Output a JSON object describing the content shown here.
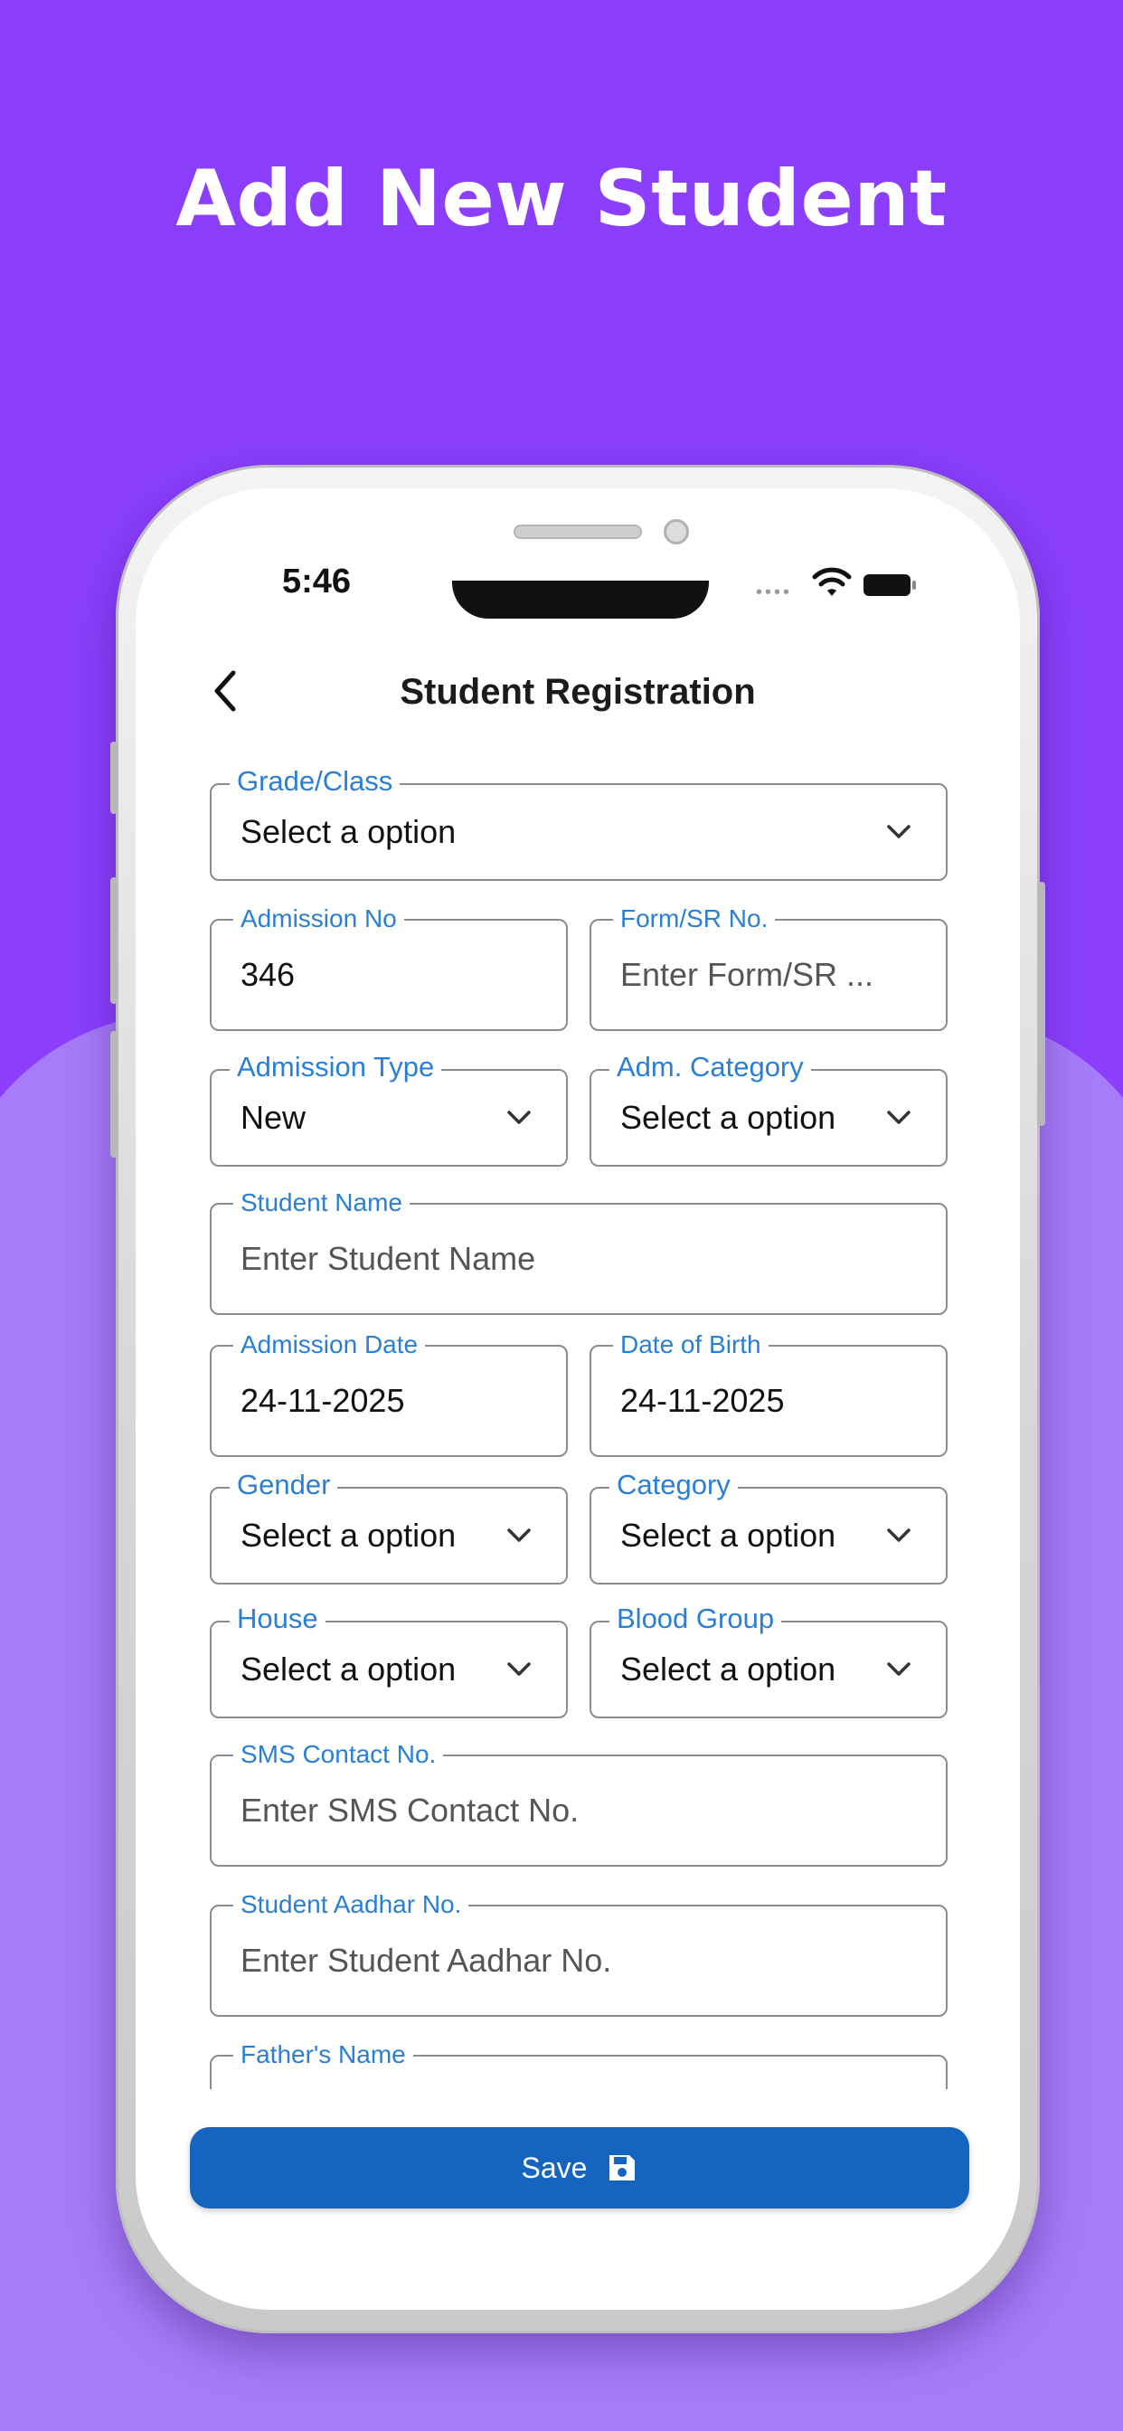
{
  "headline": "Add New Student",
  "status_bar": {
    "time": "5:46",
    "icons": [
      "signal-dots-icon",
      "wifi-icon",
      "battery-icon"
    ]
  },
  "appbar": {
    "title": "Student Registration",
    "back_icon": "chevron-left-icon"
  },
  "form": {
    "grade": {
      "label": "Grade/Class",
      "value": "Select a option"
    },
    "admission_no": {
      "label": "Admission No",
      "value": "346"
    },
    "form_sr_no": {
      "label": "Form/SR No.",
      "placeholder": "Enter Form/SR ..."
    },
    "admission_type": {
      "label": "Admission Type",
      "value": "New"
    },
    "adm_category": {
      "label": "Adm. Category",
      "value": "Select a option"
    },
    "student_name": {
      "label": "Student Name",
      "placeholder": "Enter Student Name"
    },
    "admission_date": {
      "label": "Admission Date",
      "value": "24-11-2025"
    },
    "dob": {
      "label": "Date of Birth",
      "value": "24-11-2025"
    },
    "gender": {
      "label": "Gender",
      "value": "Select a option"
    },
    "category": {
      "label": "Category",
      "value": "Select a option"
    },
    "house": {
      "label": "House",
      "value": "Select a option"
    },
    "blood_group": {
      "label": "Blood Group",
      "value": "Select a option"
    },
    "sms_contact": {
      "label": "SMS Contact No.",
      "placeholder": "Enter SMS Contact No."
    },
    "aadhar": {
      "label": "Student Aadhar No.",
      "placeholder": "Enter Student Aadhar No."
    },
    "father_name": {
      "label": "Father's Name"
    }
  },
  "save_button": {
    "label": "Save",
    "icon": "floppy-disk-icon"
  },
  "colors": {
    "bg_top": "#8b3ffd",
    "bg_bottom": "#a67cfa",
    "label": "#2a7fd4",
    "button": "#1565c0"
  }
}
